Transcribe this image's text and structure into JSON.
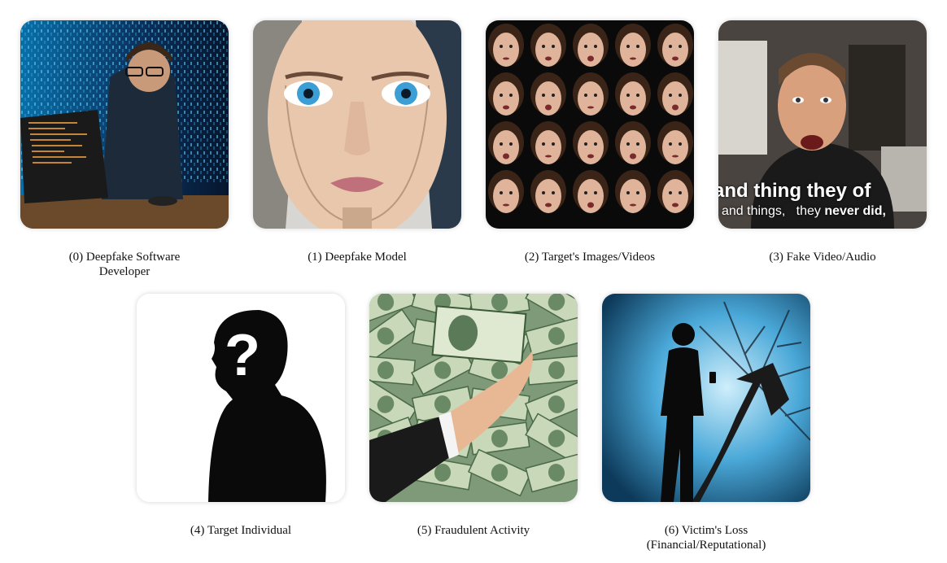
{
  "panels": [
    {
      "caption": "(0) Deepfake Software\nDeveloper",
      "image": "developer-at-laptop-with-binary-code"
    },
    {
      "caption": "(1) Deepfake Model",
      "image": "android-face"
    },
    {
      "caption": "(2) Target's Images/Videos",
      "image": "grid-of-face-expressions"
    },
    {
      "caption": "(3) Fake Video/Audio",
      "image": "man-talking-with-subtitles",
      "subtitle_line1": "and thing they of",
      "subtitle_line2_a": "and things,",
      "subtitle_line2_b": "they",
      "subtitle_line2_c": "never did,"
    },
    {
      "caption": "(4) Target Individual",
      "image": "silhouette-with-question-mark",
      "mark": "?"
    },
    {
      "caption": "(5) Fraudulent Activity",
      "image": "hand-holding-dollar-bill-over-money"
    },
    {
      "caption": "(6) Victim's Loss\n(Financial/Reputational)",
      "image": "silhouette-with-phone-and-shattered-arrow"
    }
  ]
}
